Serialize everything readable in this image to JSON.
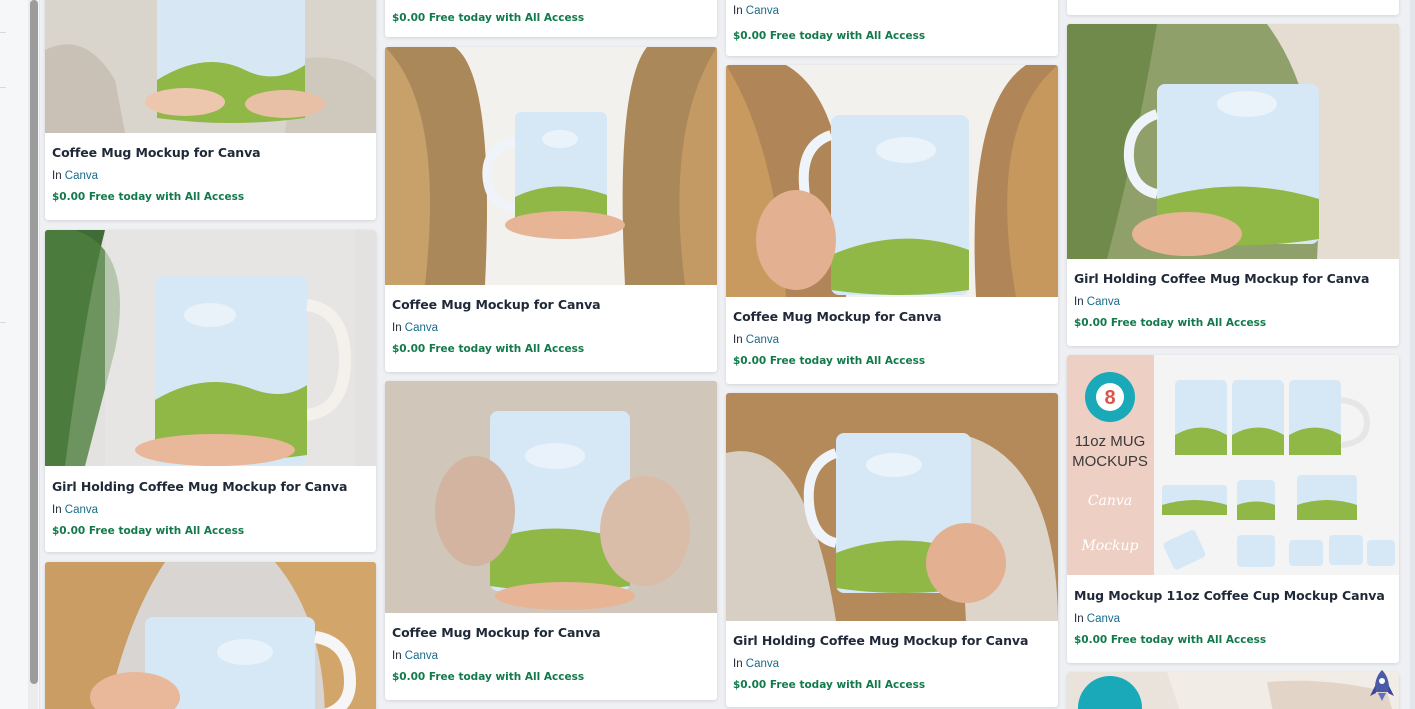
{
  "common": {
    "in_prefix": "In",
    "category": "Canva",
    "price": "$0.00 Free today with All Access"
  },
  "columns": [
    {
      "cards": [
        {
          "title": "Coffee Mug Mockup for Canva",
          "category": "Canva",
          "price": "$0.00 Free today with All Access"
        },
        {
          "title": "Girl Holding Coffee Mug Mockup for Canva",
          "category": "Canva",
          "price": "$0.00 Free today with All Access"
        }
      ]
    },
    {
      "top_price": "$0.00 Free today with All Access",
      "cards": [
        {
          "title": "Coffee Mug Mockup for Canva",
          "category": "Canva",
          "price": "$0.00 Free today with All Access"
        },
        {
          "title": "Coffee Mug Mockup for Canva",
          "category": "Canva",
          "price": "$0.00 Free today with All Access"
        }
      ]
    },
    {
      "top_category": "Canva",
      "top_price": "$0.00 Free today with All Access",
      "cards": [
        {
          "title": "Coffee Mug Mockup for Canva",
          "category": "Canva",
          "price": "$0.00 Free today with All Access"
        },
        {
          "title": "Girl Holding Coffee Mug Mockup for Canva",
          "category": "Canva",
          "price": "$0.00 Free today with All Access"
        }
      ]
    },
    {
      "cards": [
        {
          "title": "Girl Holding Coffee Mug Mockup for Canva",
          "category": "Canva",
          "price": "$0.00 Free today with All Access"
        },
        {
          "title": "Mug Mockup 11oz Coffee Cup Mockup Canva",
          "category": "Canva",
          "price": "$0.00 Free today with All Access"
        }
      ]
    }
  ],
  "promo": {
    "count": "8",
    "line1": "11oz MUG",
    "line2": "MOCKUPS",
    "script1": "Canva",
    "script2": "Mockup"
  },
  "colors": {
    "price_green": "#127a4a",
    "link_blue": "#1a6b8a",
    "mug_sky": "#cfe3f2",
    "mug_grass": "#8fb846"
  }
}
